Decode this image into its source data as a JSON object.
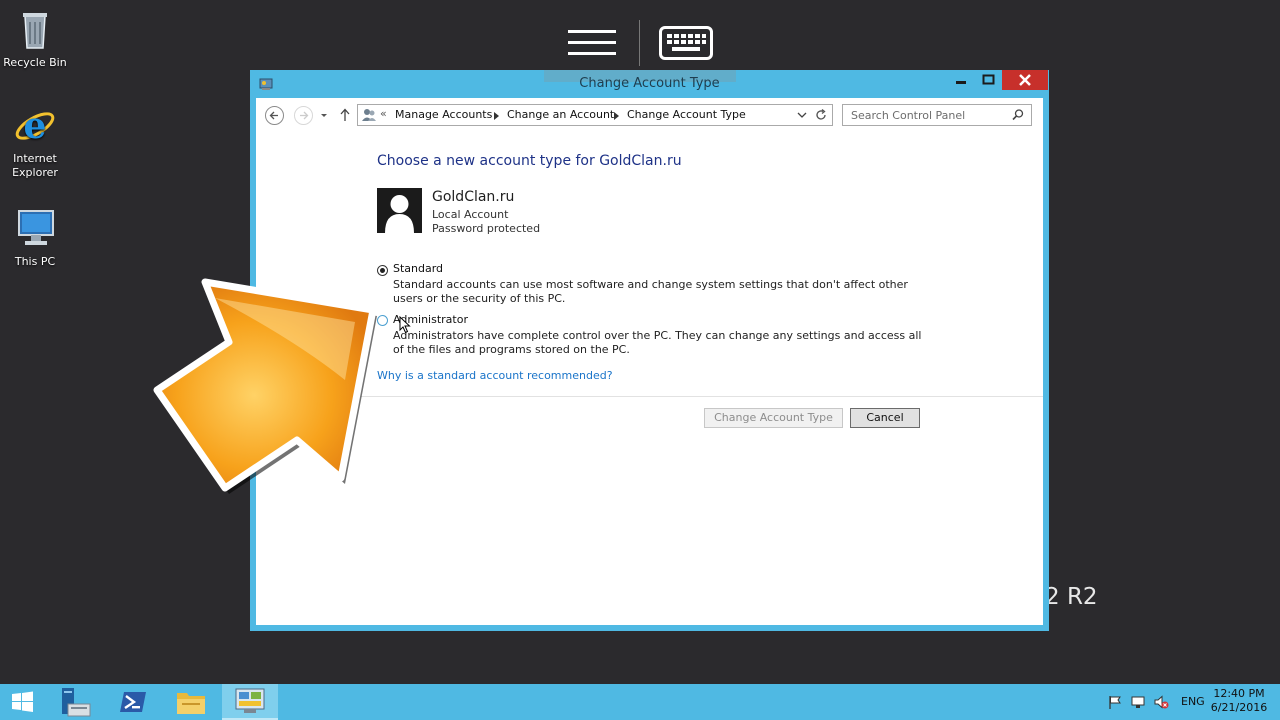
{
  "desktop": {
    "icons": [
      {
        "label": "Recycle Bin",
        "name": "recycle-bin-icon"
      },
      {
        "label": "Internet Explorer",
        "name": "internet-explorer-icon"
      },
      {
        "label": "This PC",
        "name": "this-pc-icon"
      }
    ],
    "background_text": "2 R2"
  },
  "remote_toolbar": {
    "menu_icon": "hamburger-menu-icon",
    "keyboard_icon": "keyboard-icon"
  },
  "window": {
    "title": "Change Account Type",
    "controls": [
      "minimize",
      "maximize",
      "close"
    ],
    "nav": {
      "breadcrumb_prefix": "«",
      "breadcrumbs": [
        "Manage Accounts",
        "Change an Account",
        "Change Account Type"
      ],
      "search_placeholder": "Search Control Panel"
    },
    "content": {
      "heading": "Choose a new account type for GoldClan.ru",
      "account": {
        "name": "GoldClan.ru",
        "type": "Local Account",
        "status": "Password protected"
      },
      "options": [
        {
          "label": "Standard",
          "description": "Standard accounts can use most software and change system settings that don't affect other users or the security of this PC.",
          "selected": true
        },
        {
          "label": "Administrator",
          "description": "Administrators have complete control over the PC. They can change any settings and access all of the files and programs stored on the PC.",
          "selected": false
        }
      ],
      "help_link": "Why is a standard account recommended?",
      "buttons": {
        "change": "Change Account Type",
        "cancel": "Cancel"
      }
    }
  },
  "taskbar": {
    "items": [
      "start-button",
      "server-manager",
      "powershell",
      "file-explorer",
      "control-panel"
    ],
    "tray": {
      "language": "ENG",
      "time": "12:40 PM",
      "date": "6/21/2016"
    }
  },
  "colors": {
    "window_frame": "#4fb9e3",
    "close_button": "#c7302b",
    "heading": "#1e3287",
    "link": "#1a74c9",
    "overlay_arrow": "#f7a21b"
  }
}
